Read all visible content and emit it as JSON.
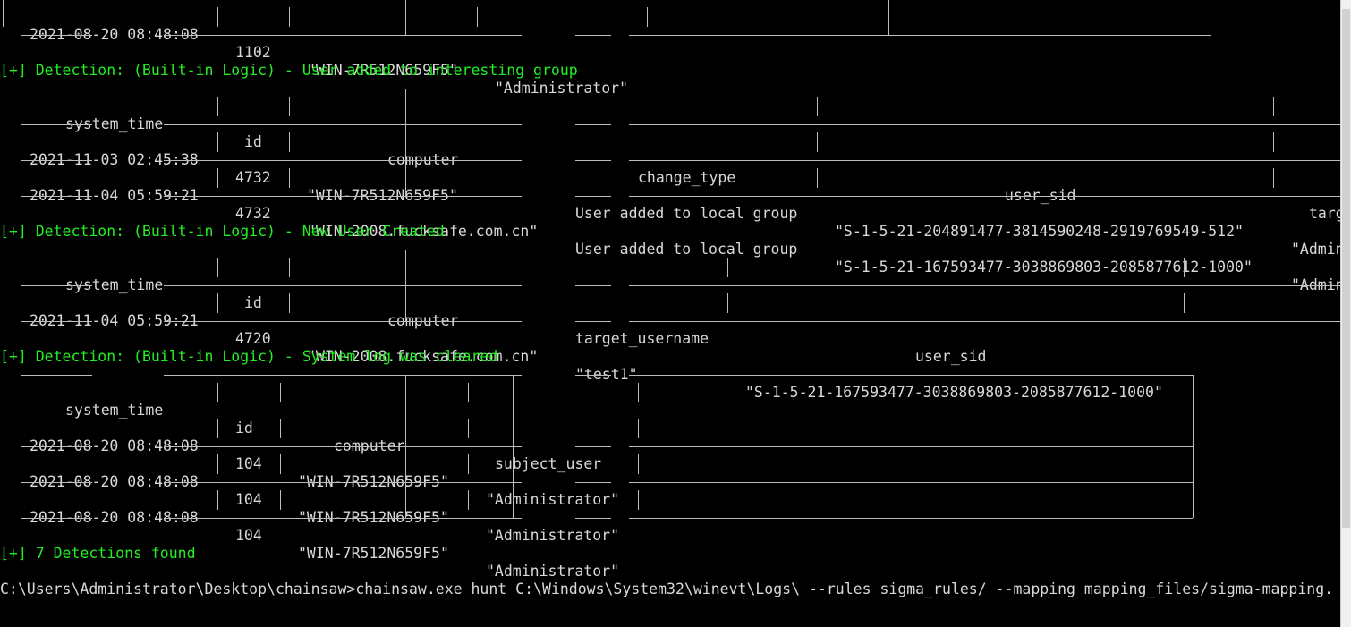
{
  "prev_table": {
    "row": [
      "2021-08-20 08:48:08",
      "1102",
      "\"WIN-7R512N659F5\"",
      "\"Administrator\""
    ]
  },
  "detections": [
    {
      "title": "[+] Detection: (Built-in Logic) - User added to interesting group",
      "headers": [
        "system_time",
        "id",
        "computer",
        "change_type",
        "user_sid",
        "targ"
      ],
      "rows": [
        [
          "2021-11-03 02:45:38",
          "4732",
          "\"WIN-7R512N659F5\"",
          "User added to local group",
          "\"S-1-5-21-204891477-3814590248-2919769549-512\"",
          "\"Admin"
        ],
        [
          "2021-11-04 05:59:21",
          "4732",
          "\"WIN-2008.fucksafe.com.cn\"",
          "User added to local group",
          "\"S-1-5-21-167593477-3038869803-2085877612-1000\"",
          "\"Admin"
        ]
      ]
    },
    {
      "title": "[+] Detection: (Built-in Logic) - New User Created",
      "headers": [
        "system_time",
        "id",
        "computer",
        "target_username",
        "user_sid"
      ],
      "rows": [
        [
          "2021-11-04 05:59:21",
          "4720",
          "\"WIN-2008.fucksafe.com.cn\"",
          "\"test1\"",
          "\"S-1-5-21-167593477-3038869803-2085877612-1000\""
        ]
      ]
    },
    {
      "title": "[+] Detection: (Built-in Logic) - System log was cleared",
      "headers": [
        "system_time",
        "id",
        "computer",
        "subject_user"
      ],
      "rows": [
        [
          "2021-08-20 08:48:08",
          "104",
          "\"WIN-7R512N659F5\"",
          "\"Administrator\""
        ],
        [
          "2021-08-20 08:48:08",
          "104",
          "\"WIN-7R512N659F5\"",
          "\"Administrator\""
        ],
        [
          "2021-08-20 08:48:08",
          "104",
          "\"WIN-7R512N659F5\"",
          "\"Administrator\""
        ]
      ]
    }
  ],
  "summary": "[+] 7 Detections found",
  "prompt": "C:\\Users\\Administrator\\Desktop\\chainsaw>chainsaw.exe hunt C:\\Windows\\System32\\winevt\\Logs\\ --rules sigma_rules/ --mapping mapping_files/sigma-mapping.",
  "colors": {
    "background": "#000000",
    "text": "#d8d8d8",
    "detection_heading": "#22ee22",
    "table_lines": "#bcbcbc"
  }
}
